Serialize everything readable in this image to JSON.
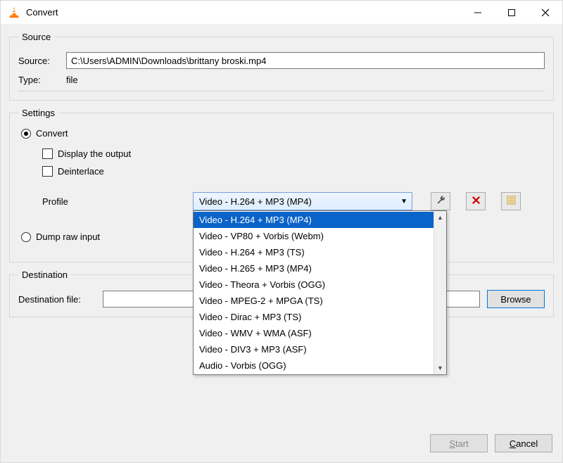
{
  "window": {
    "title": "Convert"
  },
  "source_group": {
    "legend": "Source",
    "source_label": "Source:",
    "source_value": "C:\\Users\\ADMIN\\Downloads\\brittany broski.mp4",
    "type_label": "Type:",
    "type_value": "file"
  },
  "settings_group": {
    "legend": "Settings",
    "convert_label": "Convert",
    "display_output_label": "Display the output",
    "deinterlace_label": "Deinterlace",
    "profile_label": "Profile",
    "profile_selected": "Video - H.264 + MP3 (MP4)",
    "profile_options": [
      "Video - H.264 + MP3 (MP4)",
      "Video - VP80 + Vorbis (Webm)",
      "Video - H.264 + MP3 (TS)",
      "Video - H.265 + MP3 (MP4)",
      "Video - Theora + Vorbis (OGG)",
      "Video - MPEG-2 + MPGA (TS)",
      "Video - Dirac + MP3 (TS)",
      "Video - WMV + WMA (ASF)",
      "Video - DIV3 + MP3 (ASF)",
      "Audio - Vorbis (OGG)"
    ],
    "dump_label": "Dump raw input",
    "icon_buttons": {
      "edit_tooltip": "Edit selected profile",
      "delete_tooltip": "Delete selected profile",
      "new_tooltip": "Create a new profile"
    }
  },
  "destination_group": {
    "legend": "Destination",
    "dest_label": "Destination file:",
    "dest_value": "",
    "browse_label": "Browse"
  },
  "buttons": {
    "start_prefix": "S",
    "start_rest": "tart",
    "cancel_prefix": "C",
    "cancel_rest": "ancel"
  }
}
